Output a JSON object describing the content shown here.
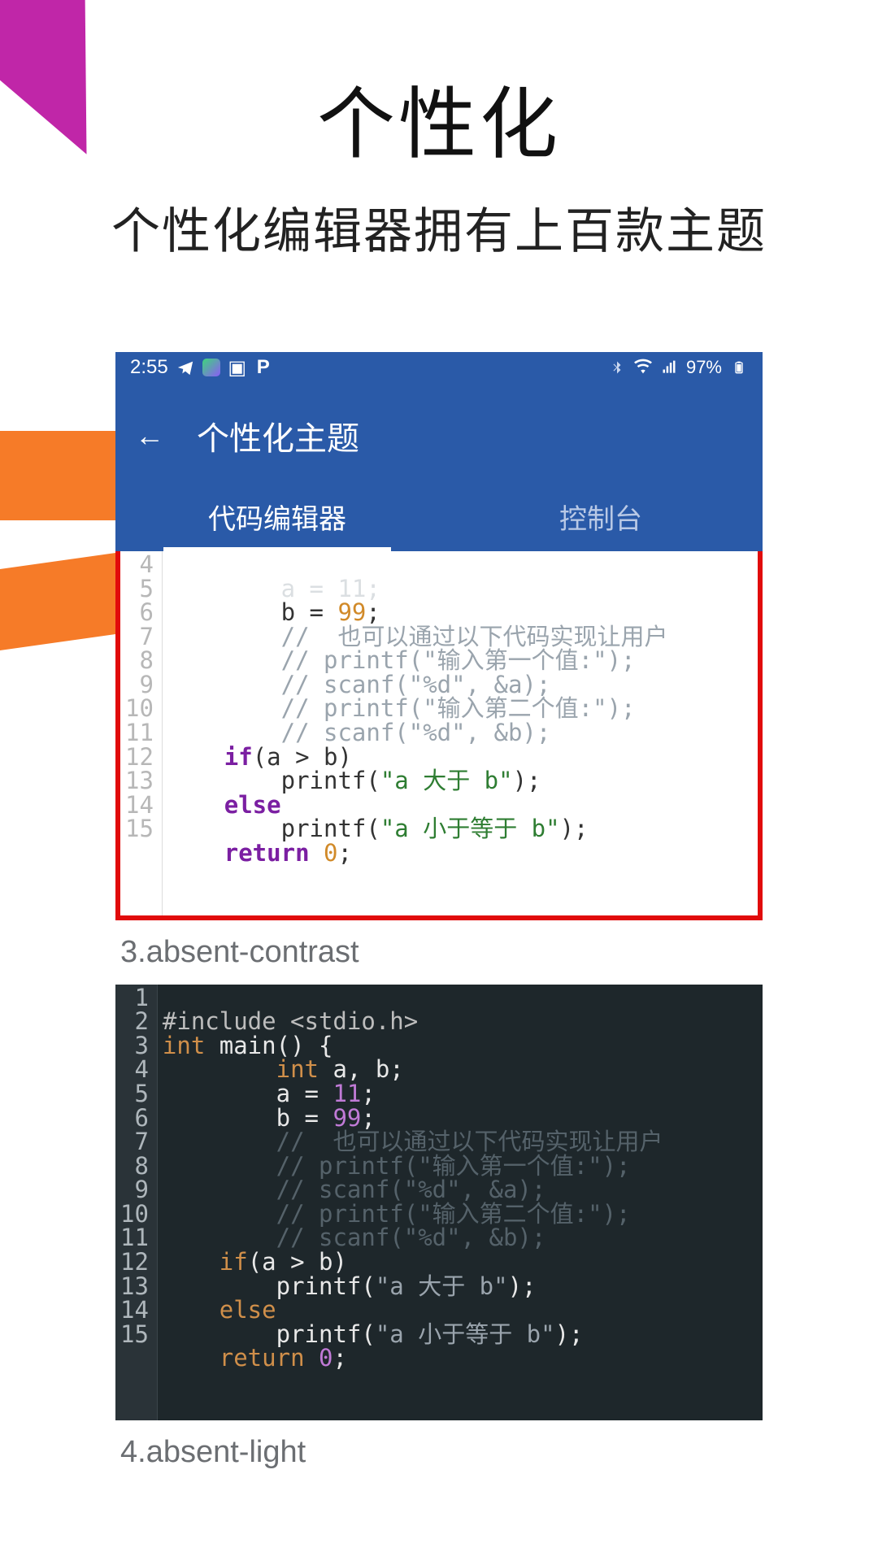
{
  "hero": {
    "title": "个性化",
    "subtitle": "个性化编辑器拥有上百款主题"
  },
  "statusbar": {
    "time": "2:55",
    "battery": "97%"
  },
  "appbar": {
    "title": "个性化主题",
    "tabs": [
      "代码编辑器",
      "控制台"
    ],
    "active": 0
  },
  "preview1": {
    "gutter": [
      "4",
      "5",
      "6",
      "7",
      "8",
      "9",
      "10",
      "11",
      "12",
      "13",
      "14",
      "15"
    ],
    "indent0": "        ",
    "indent1": "    ",
    "indent2": "        ",
    "a_line": "a = 11;",
    "b_prefix": "b = ",
    "b_num": "99",
    "b_suffix": ";",
    "cmt1": "//  也可以通过以下代码实现让用户",
    "cmt2": "// printf(\"输入第一个值:\");",
    "cmt3": "// scanf(\"%d\", &a);",
    "cmt4": "// printf(\"输入第二个值:\");",
    "cmt5": "// scanf(\"%d\", &b);",
    "if_kw": "if",
    "if_cond": "(a > b)",
    "pf": "printf(",
    "str_gt": "\"a 大于 b\"",
    "pf_end": ");",
    "else_kw": "else",
    "str_le": "\"a 小于等于 b\"",
    "ret_kw": "return ",
    "ret_num": "0",
    "ret_end": ";"
  },
  "label3": "3.absent-contrast",
  "preview2": {
    "gutter": [
      "1",
      "2",
      "3",
      "4",
      "5",
      "6",
      "7",
      "8",
      "9",
      "10",
      "11",
      "12",
      "13",
      "14",
      "15"
    ],
    "include": "#include <stdio.h>",
    "int_kw": "int ",
    "main_sig": "main() {",
    "decl_kw": "int ",
    "decl_rest": "a, b;",
    "indent0": "        ",
    "indent1": "    ",
    "indent2": "        ",
    "a_prefix": "a = ",
    "a_num": "11",
    "a_suffix": ";",
    "b_prefix": "b = ",
    "b_num": "99",
    "b_suffix": ";",
    "cmt1": "//  也可以通过以下代码实现让用户",
    "cmt2": "// printf(\"输入第一个值:\");",
    "cmt3": "// scanf(\"%d\", &a);",
    "cmt4": "// printf(\"输入第二个值:\");",
    "cmt5": "// scanf(\"%d\", &b);",
    "if_kw": "if",
    "if_cond": "(a > b)",
    "pf": "printf(",
    "str_gt": "\"a 大于 b\"",
    "pf_end": ");",
    "else_kw": "else",
    "str_le": "\"a 小于等于 b\"",
    "ret_kw": "return ",
    "ret_num": "0",
    "ret_end": ";"
  },
  "label4": "4.absent-light"
}
